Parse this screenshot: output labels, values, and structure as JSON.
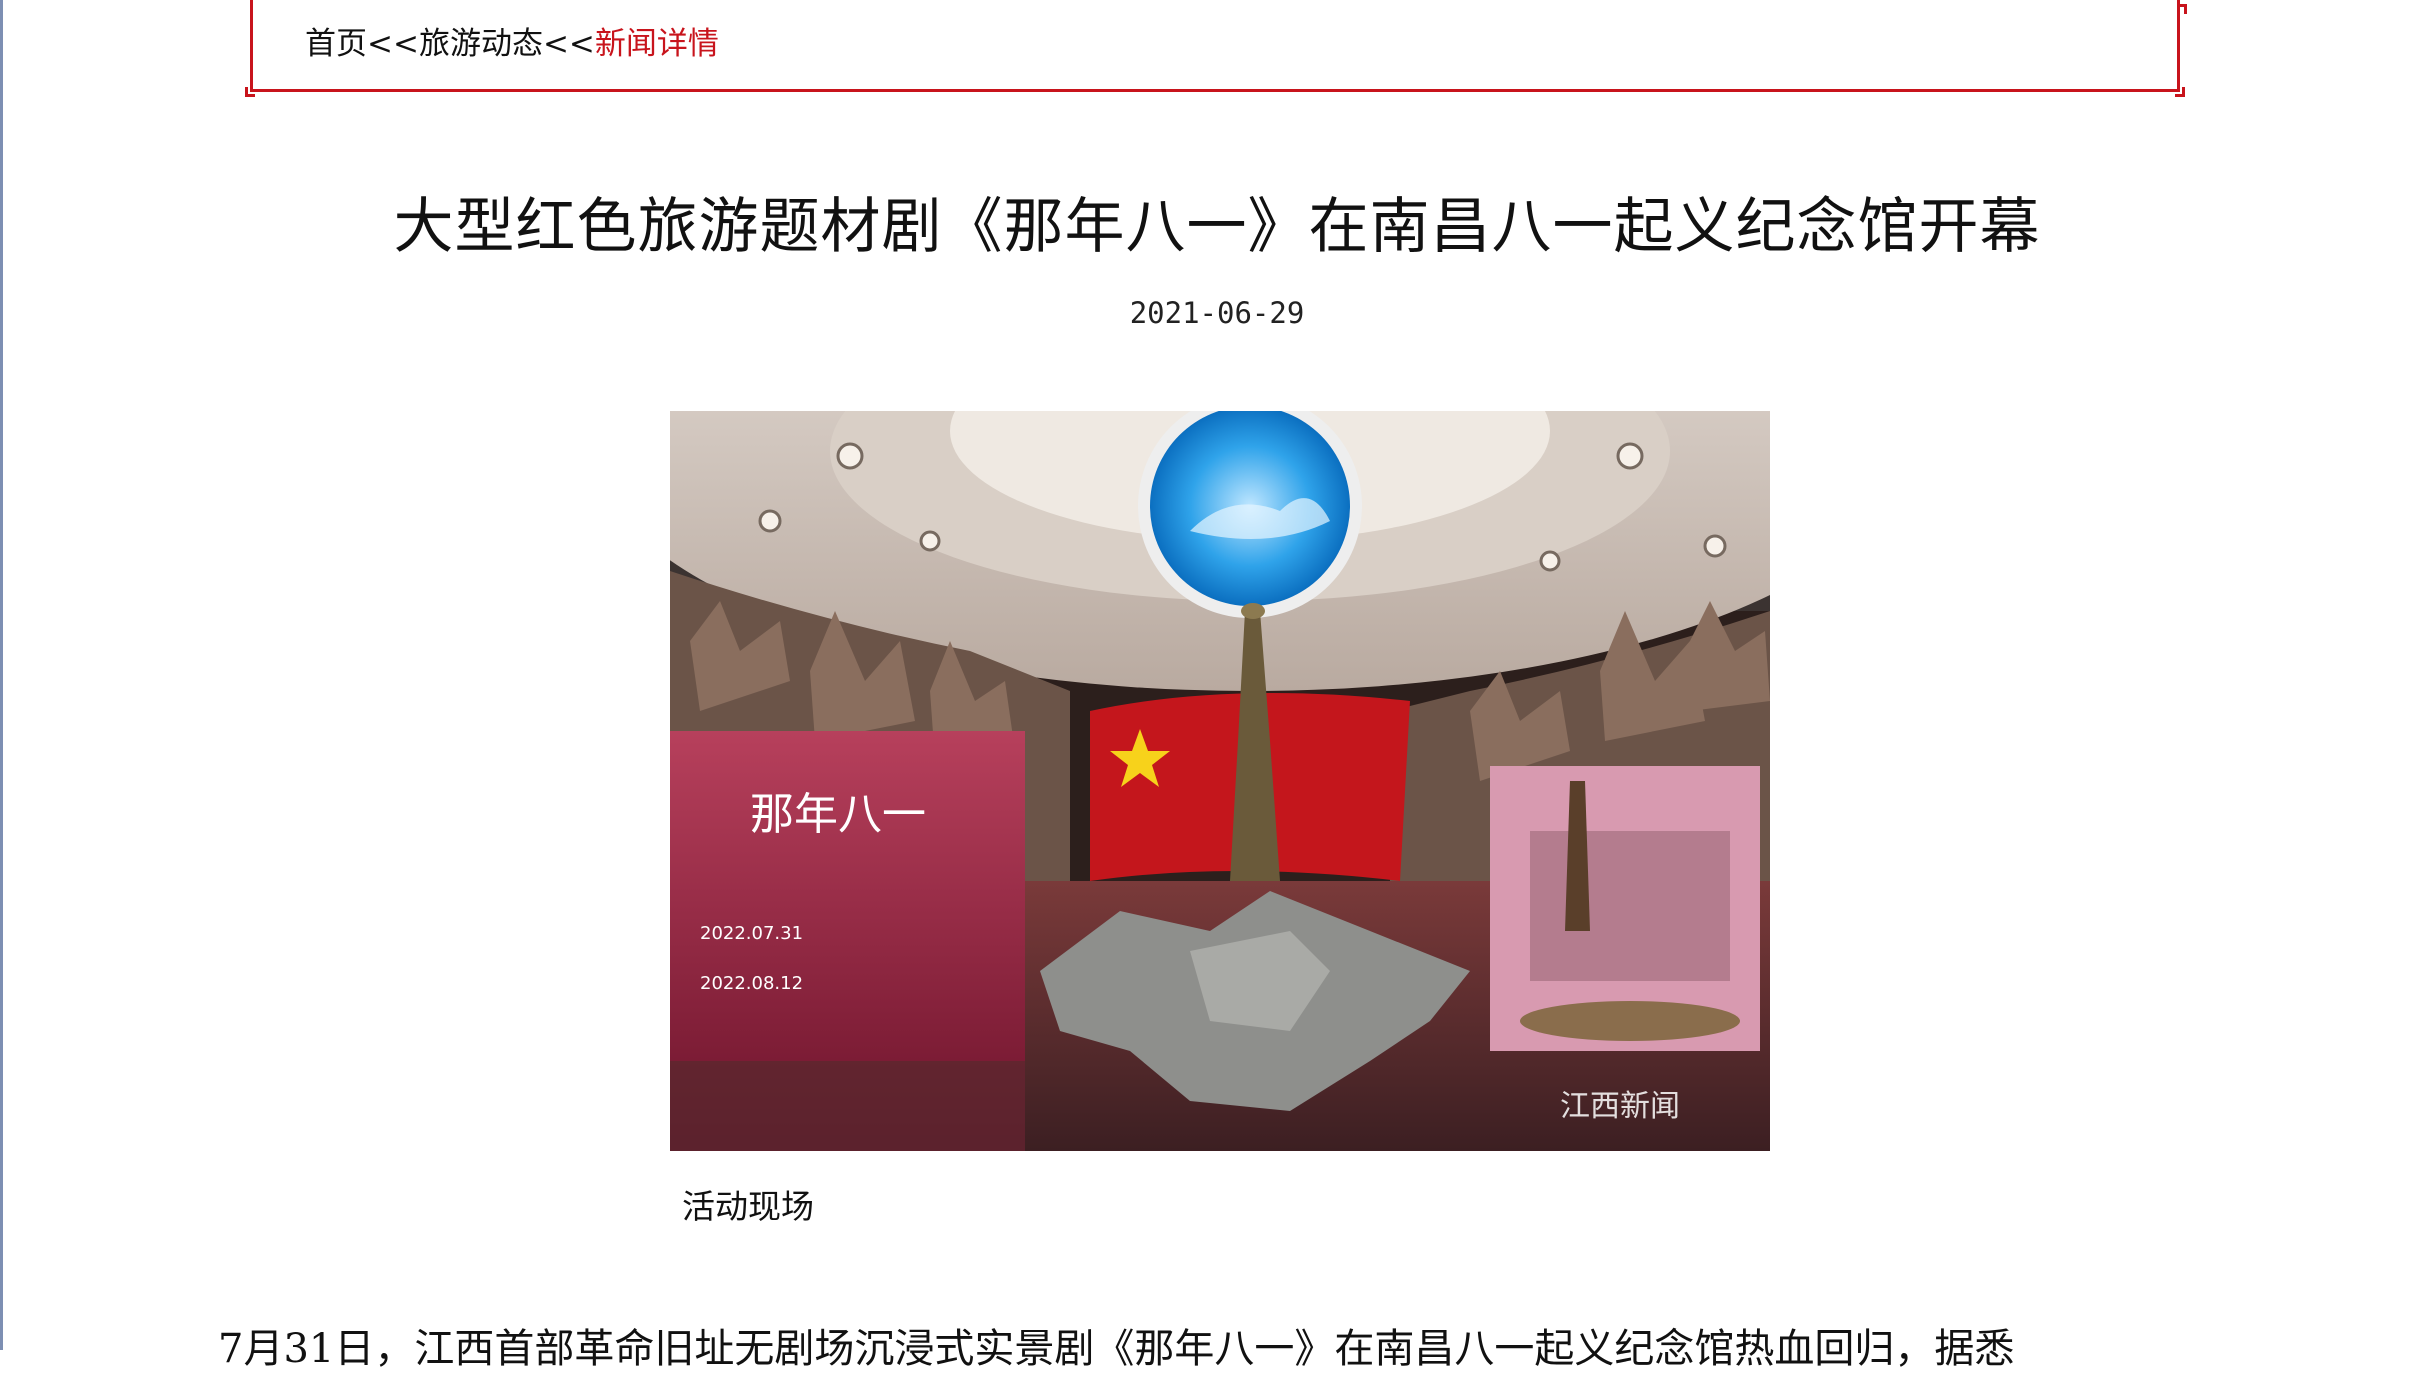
{
  "breadcrumb": {
    "home": "首页",
    "sep1": "<<",
    "section": "旅游动态",
    "sep2": "<<",
    "current": "新闻详情"
  },
  "article": {
    "title": "大型红色旅游题材剧《那年八一》在南昌八一起义纪念馆开幕",
    "date": "2021-06-29",
    "image_caption": "活动现场",
    "body_first_line": "7月31日，江西首部革命旧址无剧场沉浸式实景剧《那年八一》在南昌八一起义纪念馆热血回归，据悉"
  },
  "photo": {
    "poster_title": "那年八一",
    "poster_date1": "2022.07.31",
    "poster_date2": "2022.08.12",
    "watermark": "江西新闻"
  },
  "colors": {
    "accent_red": "#c8141c",
    "text": "#111111"
  }
}
